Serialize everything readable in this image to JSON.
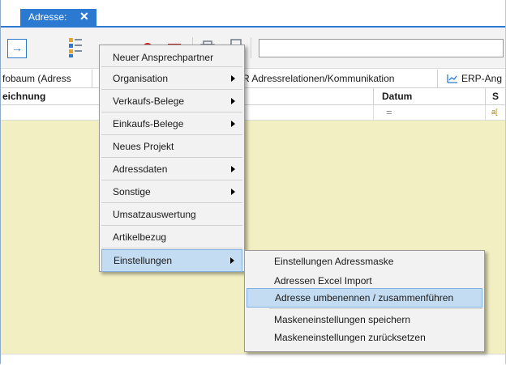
{
  "tab": {
    "label": "Adresse:",
    "close": "✕"
  },
  "toolbar": {
    "go_symbol": "→",
    "search_value": ""
  },
  "tabrow": {
    "left_label": "fobaum (Adress",
    "middle_label": "R Adressrelationen/Kommunikation",
    "right_label": "ERP-Ang"
  },
  "grid": {
    "headers": {
      "col1": "eichnung",
      "datum": "Datum",
      "s": "S"
    },
    "filter": {
      "eq": "=",
      "small": "a["
    }
  },
  "context_menu": {
    "items": [
      {
        "label": "Neuer Ansprechpartner",
        "submenu": false
      },
      {
        "label": "Organisation",
        "submenu": true
      },
      {
        "label": "Verkaufs-Belege",
        "submenu": true
      },
      {
        "label": "Einkaufs-Belege",
        "submenu": true
      },
      {
        "label": "Neues Projekt",
        "submenu": false
      },
      {
        "label": "Adressdaten",
        "submenu": true
      },
      {
        "label": "Sonstige",
        "submenu": true
      },
      {
        "label": "Umsatzauswertung",
        "submenu": false
      },
      {
        "label": "Artikelbezug",
        "submenu": false
      },
      {
        "label": "Einstellungen",
        "submenu": true,
        "active": true
      }
    ]
  },
  "submenu": {
    "items": [
      {
        "label": "Einstellungen Adressmaske"
      },
      {
        "label": "Adressen Excel Import"
      },
      {
        "label": "Adresse umbenennen / zusammenführen",
        "highlighted": true
      },
      {
        "label": "Maskeneinstellungen speichern"
      },
      {
        "label": "Maskeneinstellungen zurücksetzen"
      }
    ]
  },
  "colors": {
    "accent": "#2b79d0",
    "grid_body": "#f2f0c2",
    "menu_bg": "#f2f2f2",
    "highlight": "#c4dcf2"
  },
  "icons": [
    "arrow-right-icon",
    "list-view-icon",
    "folder-icon",
    "alarm-clock-icon",
    "calendar-icon",
    "print-icon",
    "document-icon",
    "chart-icon"
  ]
}
